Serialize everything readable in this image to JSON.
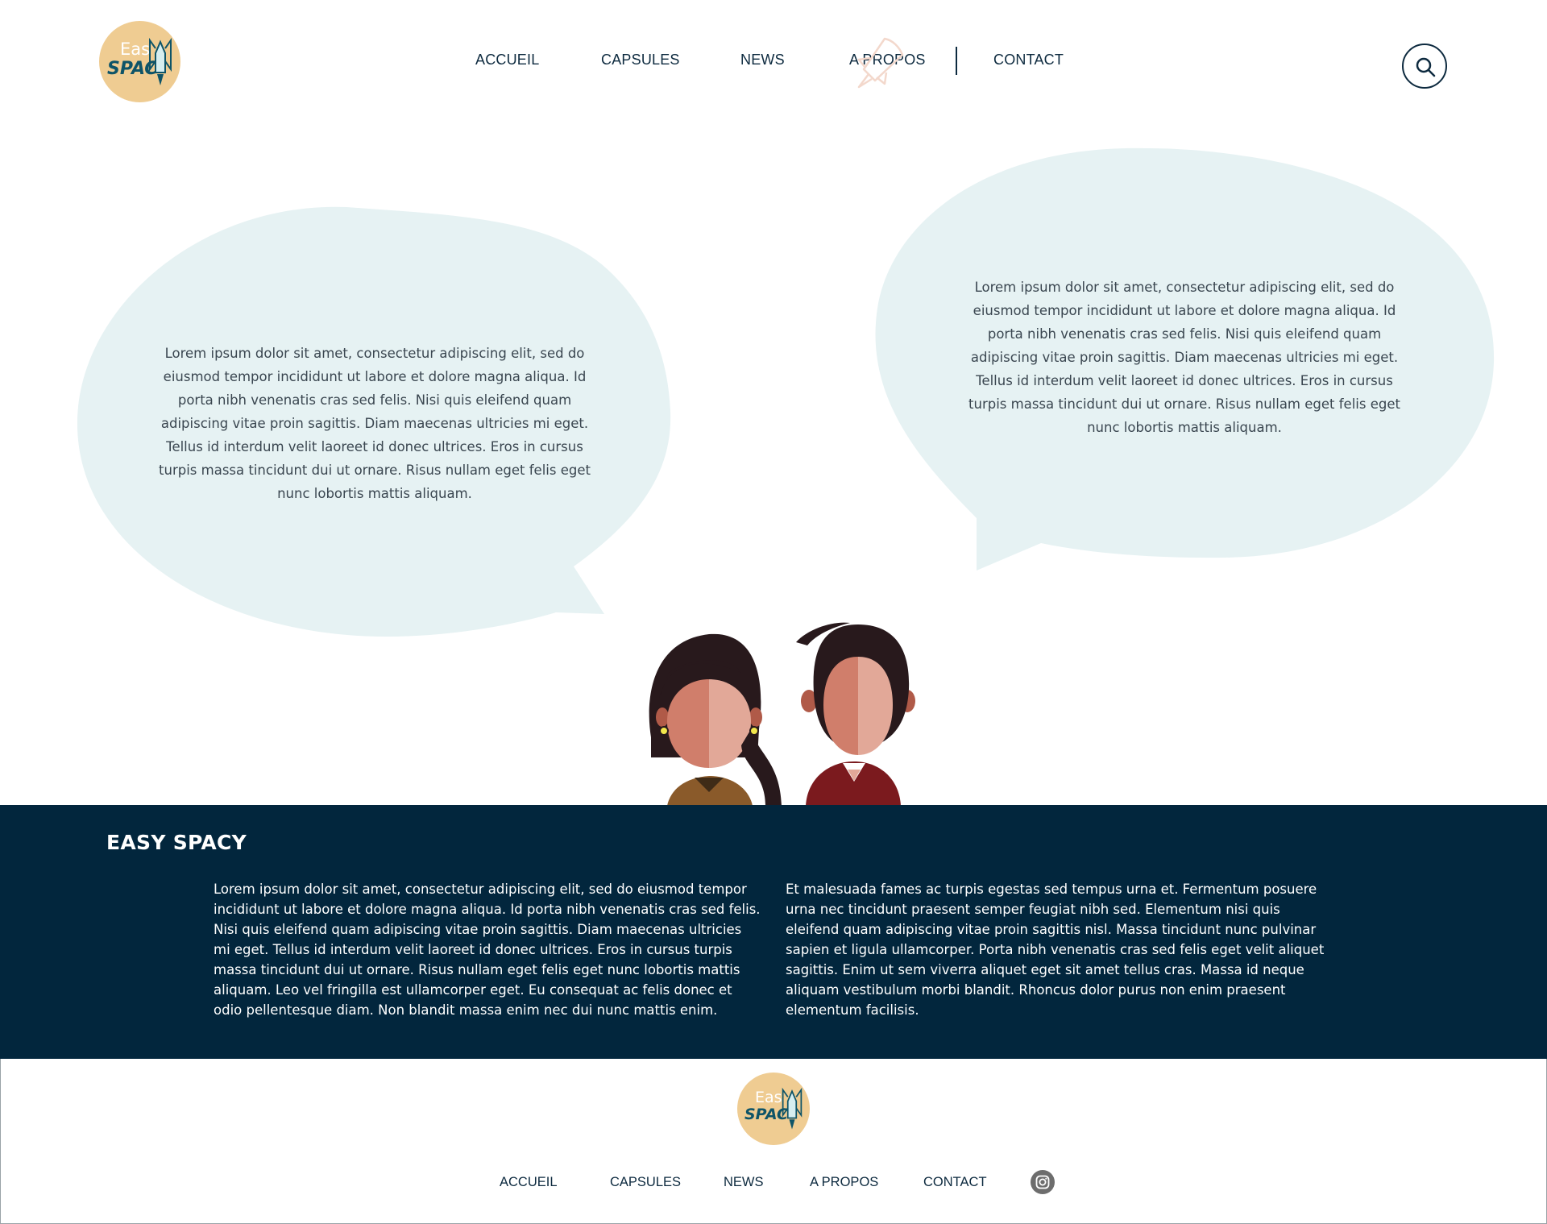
{
  "brand": {
    "logo_top": "Eas",
    "logo_bottom": "SPAC",
    "name": "EASY SPACY",
    "accent_color": "#efcc92",
    "dark_color": "#02263d",
    "bubble_color": "#e6f2f3"
  },
  "nav": {
    "items": [
      "ACCUEIL",
      "CAPSULES",
      "NEWS",
      "A PROPOS",
      "CONTACT"
    ]
  },
  "icons": {
    "search": "search-icon",
    "rocket": "rocket-icon",
    "instagram": "instagram-icon"
  },
  "bubbles": {
    "left": "Lorem ipsum dolor sit amet, consectetur adipiscing elit, sed do eiusmod tempor incididunt ut labore et dolore magna aliqua. Id porta nibh venenatis cras sed felis. Nisi quis eleifend quam adipiscing vitae proin sagittis. Diam maecenas ultricies mi eget. Tellus id interdum velit laoreet id donec ultrices. Eros in cursus turpis massa tincidunt dui ut ornare. Risus nullam eget felis eget nunc lobortis mattis aliquam.",
    "right": "Lorem ipsum dolor sit amet, consectetur adipiscing elit, sed do eiusmod tempor incididunt ut labore et dolore magna aliqua. Id porta nibh venenatis cras sed felis. Nisi quis eleifend quam adipiscing vitae proin sagittis. Diam maecenas ultricies mi eget. Tellus id interdum velit laoreet id donec ultrices. Eros in cursus turpis massa tincidunt dui ut ornare. Risus nullam eget felis eget nunc lobortis mattis aliquam."
  },
  "band": {
    "col1": "Lorem ipsum dolor sit amet, consectetur adipiscing elit, sed do eiusmod tempor incididunt ut labore et dolore magna aliqua. Id porta nibh venenatis cras sed felis. Nisi quis eleifend quam adipiscing vitae proin sagittis. Diam maecenas ultricies mi eget. Tellus id interdum velit laoreet id donec ultrices. Eros in cursus turpis massa tincidunt dui ut ornare. Risus nullam eget felis eget nunc lobortis mattis aliquam. Leo vel fringilla est ullamcorper eget. Eu consequat ac felis donec et odio pellentesque diam. Non blandit massa enim nec dui nunc mattis enim.",
    "col2": "Et malesuada fames ac turpis egestas sed tempus urna et. Fermentum posuere urna nec tincidunt praesent semper feugiat nibh sed. Elementum nisi quis eleifend quam adipiscing vitae proin sagittis nisl. Massa tincidunt nunc pulvinar sapien et ligula ullamcorper. Porta nibh venenatis cras sed felis eget velit aliquet sagittis. Enim ut sem viverra aliquet eget sit amet tellus cras. Massa id neque aliquam vestibulum morbi blandit. Rhoncus dolor purus non enim praesent elementum facilisis."
  },
  "footer": {
    "nav": [
      "ACCUEIL",
      "CAPSULES",
      "NEWS",
      "A PROPOS",
      "CONTACT"
    ]
  }
}
